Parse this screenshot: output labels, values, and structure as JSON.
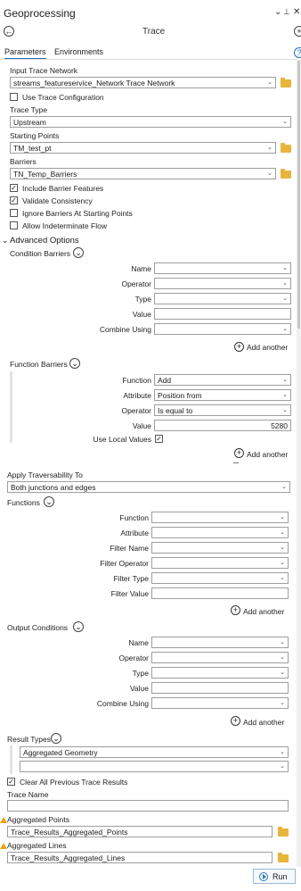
{
  "pane": {
    "title": "Geoprocessing",
    "menu_glyph": "⌄",
    "pin_glyph": "⊥",
    "close_glyph": "✕"
  },
  "tool": {
    "title": "Trace",
    "back_glyph": "←",
    "add_glyph": "+"
  },
  "tabs": {
    "parameters": "Parameters",
    "environments": "Environments",
    "help_glyph": "?"
  },
  "params": {
    "input_trace_network": {
      "label": "Input Trace Network",
      "value": "streams_featureservice_Network Trace Network"
    },
    "use_trace_config": {
      "label": "Use Trace Configuration"
    },
    "trace_type": {
      "label": "Trace Type",
      "value": "Upstream"
    },
    "starting_points": {
      "label": "Starting Points",
      "value": "TM_test_pt"
    },
    "barriers": {
      "label": "Barriers",
      "value": "TN_Temp_Barriers"
    },
    "include_barrier": {
      "label": "Include Barrier Features"
    },
    "validate": {
      "label": "Validate Consistency"
    },
    "ignore_barriers": {
      "label": "Ignore Barriers At Starting Points"
    },
    "allow_indeterminate": {
      "label": "Allow Indeterminate Flow"
    }
  },
  "advanced": {
    "title": "Advanced Options",
    "condition_barriers": {
      "label": "Condition Barriers",
      "name": "Name",
      "operator": "Operator",
      "type": "Type",
      "value": "Value",
      "combine": "Combine Using",
      "add": "Add another"
    },
    "function_barriers": {
      "label": "Function Barriers",
      "function_label": "Function",
      "function_value": "Add",
      "attribute_label": "Attribute",
      "attribute_value": "Position from",
      "operator_label": "Operator",
      "operator_value": "Is equal to",
      "value_label": "Value",
      "value_value": "5280",
      "local_label": "Use Local Values",
      "add": "Add another"
    },
    "traversability": {
      "label": "Apply Traversability To",
      "value": "Both junctions and edges"
    },
    "functions": {
      "label": "Functions",
      "function": "Function",
      "attribute": "Attribute",
      "filter_name": "Filter Name",
      "filter_operator": "Filter Operator",
      "filter_type": "Filter Type",
      "filter_value": "Filter Value",
      "add": "Add another"
    },
    "output_conditions": {
      "label": "Output Conditions",
      "name": "Name",
      "operator": "Operator",
      "type": "Type",
      "value": "Value",
      "combine": "Combine Using",
      "add": "Add another"
    },
    "result_types": {
      "label": "Result Types",
      "value": "Aggregated Geometry"
    },
    "clear_previous": {
      "label": "Clear All Previous Trace Results"
    },
    "trace_name": {
      "label": "Trace Name",
      "value": ""
    },
    "aggregated_points": {
      "label": "Aggregated Points",
      "value": "Trace_Results_Aggregated_Points"
    },
    "aggregated_lines": {
      "label": "Aggregated Lines",
      "value": "Trace_Results_Aggregated_Lines"
    }
  },
  "run": {
    "label": "Run"
  },
  "glyphs": {
    "chevron": "⌄",
    "check": "✓",
    "plus": "+",
    "collapse": "⌄"
  }
}
